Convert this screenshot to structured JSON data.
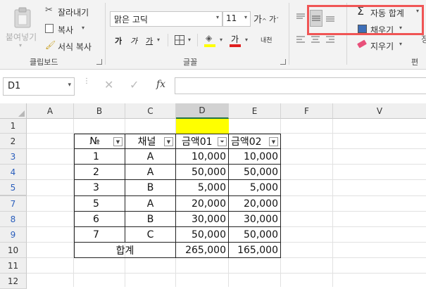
{
  "ribbon": {
    "clipboard": {
      "paste_label": "붙여넣기",
      "cut_label": "잘라내기",
      "copy_label": "복사",
      "format_painter_label": "서식 복사",
      "group_title": "클립보드"
    },
    "font": {
      "font_name": "맑은 고딕",
      "font_size": "11",
      "bold": "가",
      "italic": "가",
      "underline": "가",
      "font_color_glyph": "가",
      "phonetic_glyph": "내천",
      "group_title": "글꼴"
    },
    "editing": {
      "autosum_label": "자동 합계",
      "fill_label": "채우기",
      "clear_label": "지우기",
      "group_title": "편"
    },
    "colors": {
      "highlight": "#ffff00",
      "font_color": "#e02020",
      "red_box": "#f05555"
    }
  },
  "formula_bar": {
    "name_box": "D1",
    "fx": "fx",
    "content": ""
  },
  "sheet": {
    "columns": [
      "A",
      "B",
      "C",
      "D",
      "E",
      "F",
      "V"
    ],
    "rows": [
      "1",
      "2",
      "3",
      "4",
      "5",
      "7",
      "8",
      "9",
      "10",
      "11",
      "12"
    ],
    "filtered_rows_color": "#2a5ebc",
    "header_highlight": "#d2d2d2",
    "table": {
      "headers": [
        "№",
        "채널",
        "금액01",
        "금액02"
      ],
      "rows": [
        [
          "1",
          "A",
          "10,000",
          "10,000"
        ],
        [
          "2",
          "A",
          "50,000",
          "50,000"
        ],
        [
          "3",
          "B",
          "5,000",
          "5,000"
        ],
        [
          "5",
          "A",
          "20,000",
          "20,000"
        ],
        [
          "6",
          "B",
          "30,000",
          "30,000"
        ],
        [
          "7",
          "C",
          "50,000",
          "50,000"
        ]
      ],
      "total_label": "합계",
      "total_d": "265,000",
      "total_e": "165,000"
    },
    "selected_cell": "D1",
    "selected_fill": "#ffff00"
  }
}
